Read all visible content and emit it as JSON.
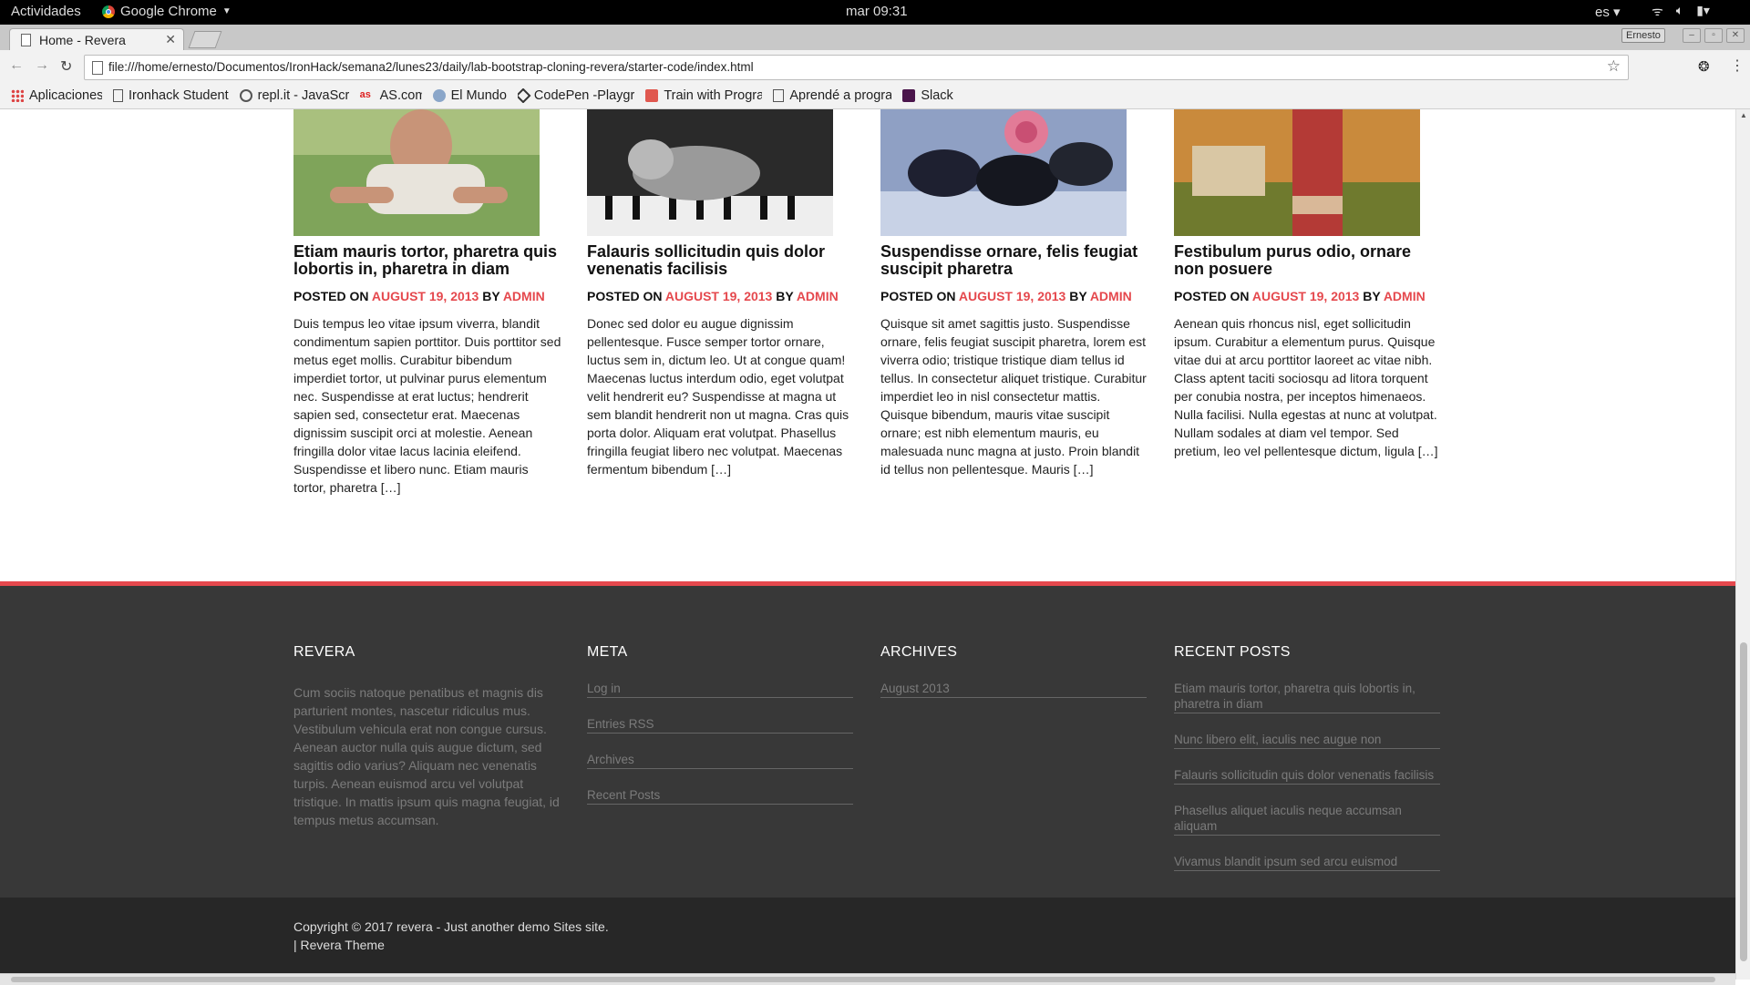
{
  "system": {
    "activities": "Actividades",
    "app_name": "Google Chrome",
    "clock": "mar 09:31",
    "lang": "es"
  },
  "browser": {
    "tab_title": "Home - Revera",
    "user": "Ernesto",
    "url": "file:///home/ernesto/Documentos/IronHack/semana2/lunes23/daily/lab-bootstrap-cloning-revera/starter-code/index.html",
    "bookmarks": [
      {
        "label": "Aplicaciones",
        "icon": "apps-grid-icon"
      },
      {
        "label": "Ironhack Student",
        "icon": "page-icon"
      },
      {
        "label": "repl.it - JavaScrip",
        "icon": "replit-icon"
      },
      {
        "label": "AS.com",
        "icon": "as-icon"
      },
      {
        "label": "El Mundo",
        "icon": "globe-icon"
      },
      {
        "label": "CodePen -Playgr",
        "icon": "codepen-icon"
      },
      {
        "label": "Train with Progra",
        "icon": "codewars-icon"
      },
      {
        "label": "Aprendé a progra",
        "icon": "doc-icon"
      },
      {
        "label": "Slack",
        "icon": "slack-icon"
      }
    ]
  },
  "posts": [
    {
      "title": "Etiam mauris tortor, pharetra quis lobortis in, pharetra in diam",
      "posted_on": "POSTED ON",
      "date": "AUGUST 19, 2013",
      "by": "BY",
      "author": "ADMIN",
      "excerpt": "Duis tempus leo vitae ipsum viverra, blandit condimentum sapien porttitor. Duis porttitor sed metus eget mollis. Curabitur bibendum imperdiet tortor, ut pulvinar purus elementum nec. Suspendisse at erat luctus; hendrerit sapien sed, consectetur erat. Maecenas dignissim suscipit orci at molestie. Aenean fringilla dolor vitae lacus lacinia eleifend. Suspendisse et libero nunc. Etiam mauris tortor, pharetra […]"
    },
    {
      "title": "Falauris sollicitudin quis dolor venenatis facilisis",
      "posted_on": "POSTED ON",
      "date": "AUGUST 19, 2013",
      "by": "BY",
      "author": "ADMIN",
      "excerpt": "Donec sed dolor eu augue dignissim pellentesque. Fusce semper tortor ornare, luctus sem in, dictum leo. Ut at congue quam! Maecenas luctus interdum odio, eget volutpat velit hendrerit eu? Suspendisse at magna ut sem blandit hendrerit non ut magna. Cras quis porta dolor. Aliquam erat volutpat. Phasellus fringilla feugiat libero nec volutpat. Maecenas fermentum bibendum […]"
    },
    {
      "title": "Suspendisse ornare, felis feugiat suscipit pharetra",
      "posted_on": "POSTED ON",
      "date": "AUGUST 19, 2013",
      "by": "BY",
      "author": "ADMIN",
      "excerpt": "Quisque sit amet sagittis justo. Suspendisse ornare, felis feugiat suscipit pharetra, lorem est viverra odio; tristique tristique diam tellus id tellus. In consectetur aliquet tristique. Curabitur imperdiet leo in nisl consectetur mattis. Quisque bibendum, mauris vitae suscipit ornare; est nibh elementum mauris, eu malesuada nunc magna at justo. Proin blandit id tellus non pellentesque. Mauris […]"
    },
    {
      "title": "Festibulum purus odio, ornare non posuere",
      "posted_on": "POSTED ON",
      "date": "AUGUST 19, 2013",
      "by": "BY",
      "author": "ADMIN",
      "excerpt": "Aenean quis rhoncus nisl, eget sollicitudin ipsum. Curabitur a elementum purus. Quisque vitae dui at arcu porttitor laoreet ac vitae nibh. Class aptent taciti sociosqu ad litora torquent per conubia nostra, per inceptos himenaeos. Nulla facilisi. Nulla egestas at nunc at volutpat. Nullam sodales at diam vel tempor. Sed pretium, leo vel pellentesque dictum, ligula […]"
    }
  ],
  "footer": {
    "revera": {
      "heading": "REVERA",
      "text": "Cum sociis natoque penatibus et magnis dis parturient montes, nascetur ridiculus mus. Vestibulum vehicula erat non congue cursus. Aenean auctor nulla quis augue dictum, sed sagittis odio varius? Aliquam nec venenatis turpis. Aenean euismod arcu vel volutpat tristique. In mattis ipsum quis magna feugiat, id tempus metus accumsan."
    },
    "meta": {
      "heading": "META",
      "links": [
        "Log in",
        "Entries RSS",
        "Archives",
        "Recent Posts"
      ]
    },
    "archives": {
      "heading": "ARCHIVES",
      "links": [
        "August 2013"
      ]
    },
    "recent": {
      "heading": "RECENT POSTS",
      "links": [
        "Etiam mauris tortor, pharetra quis lobortis in, pharetra in diam",
        "Nunc libero elit, iaculis nec augue non",
        "Falauris sollicitudin quis dolor venenatis facilisis",
        "Phasellus aliquet iaculis neque accumsan aliquam",
        "Vivamus blandit ipsum sed arcu euismod"
      ]
    },
    "copyright_line1": "Copyright © 2017 revera - Just another demo Sites site.",
    "copyright_line2": "| Revera Theme"
  },
  "colors": {
    "accent": "#e5484d",
    "footer_bg": "#383838",
    "bottom_bg": "#272727"
  }
}
